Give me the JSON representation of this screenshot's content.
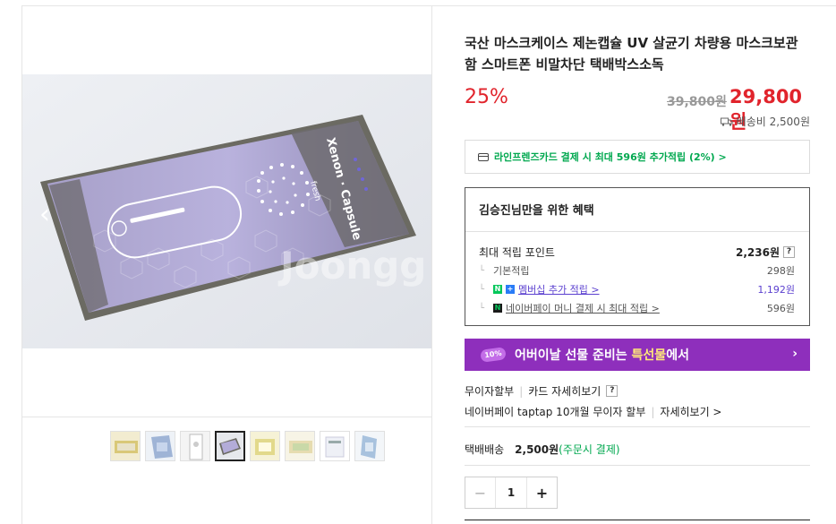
{
  "product": {
    "title": "국산 마스크케이스 제논캡슐 UV 살균기 차량용 마스크보관함 스마트폰 비말차단 택배박스소독",
    "discount": "25%",
    "original_price": "39,800원",
    "sale_price": "29,800원",
    "shipping_fee_note": "배송비 2,500원"
  },
  "gallery": {
    "image_watermark": "Joongg",
    "device_label": "Xenon · Capsule",
    "device_sublabel": "fresh",
    "prev_icon": "‹",
    "next_icon": "›",
    "thumbnails": 8,
    "active_thumbnail": 4
  },
  "card_offer": {
    "text": "라인프렌즈카드 결제 시 최대 596원 추가적립 (2%) >"
  },
  "benefits": {
    "header": "김승진님만을 위한 혜택",
    "max_points_label": "최대 적립 포인트",
    "max_points_value": "2,236원",
    "rows": [
      {
        "label": "기본적립",
        "value": "298원"
      },
      {
        "label": "멤버십 추가 적립 >",
        "value": "1,192원"
      },
      {
        "label": "네이버페이 머니 결제 시 최대 적립 >",
        "value": "596원"
      }
    ]
  },
  "banner": {
    "icon_text": "10%",
    "text_before": "어버이날 선물 준비는 ",
    "text_highlight": "특선물",
    "text_after": "에서",
    "arrow": "›"
  },
  "payment": {
    "installment": "무이자할부",
    "card_details": "카드 자세히보기",
    "naverpay": "네이버페이 taptap 10개월 무이자 할부",
    "details": "자세히보기 >"
  },
  "delivery": {
    "label": "택배배송",
    "price": "2,500원",
    "condition": "(주문시 결제)"
  },
  "quantity": {
    "minus": "−",
    "value": "1",
    "plus": "+"
  },
  "colors": {
    "accent_red": "#e1242c",
    "naver_green": "#00a84f",
    "banner_purple": "#8e2fbc"
  }
}
